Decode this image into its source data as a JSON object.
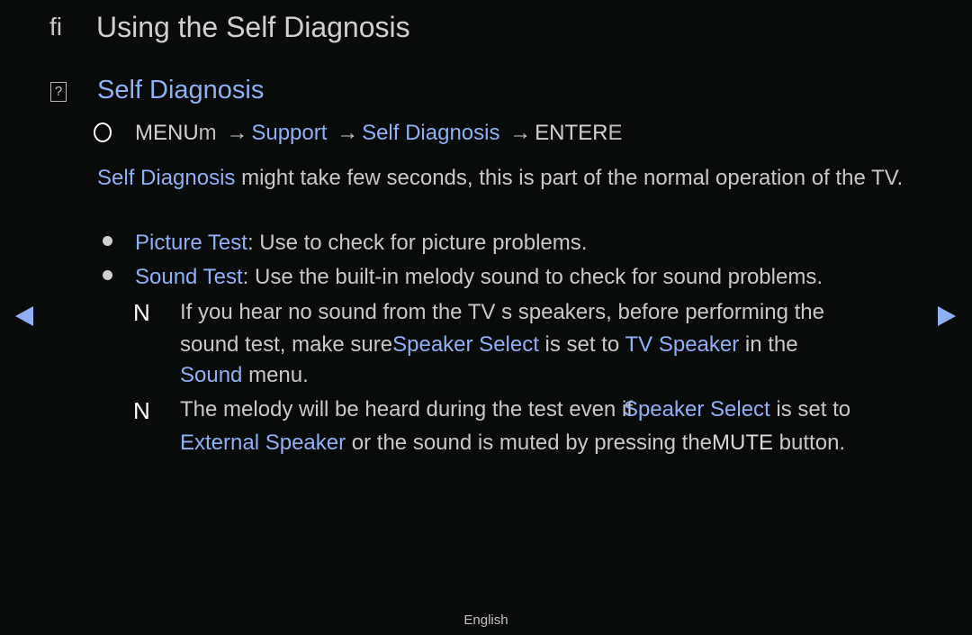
{
  "header": {
    "title_glyph": "ﬁ",
    "title": "Using the Self Diagnosis"
  },
  "section": {
    "glyph": "?",
    "title": "Self Diagnosis"
  },
  "menu_path": {
    "o_icon": "remote-button-icon",
    "menu": "MENU",
    "menu_suffix": "m",
    "arrow": "→",
    "support": "Support",
    "self_diagnosis": "Self Diagnosis",
    "enter": "ENTER",
    "enter_suffix": "E"
  },
  "intro": {
    "highlight": "Self Diagnosis",
    "text": " might take few seconds, this is part of the normal operation of the TV."
  },
  "bullets": [
    {
      "label": "Picture Test",
      "text": ": Use to check for picture problems."
    },
    {
      "label": "Sound Test",
      "text": ": Use the built-in melody sound to check for sound problems."
    }
  ],
  "notes": [
    {
      "glyph": "N",
      "line1": "If you hear no sound from the TV s speakers, before performing the",
      "line2_pre": "sound test, make sure",
      "line2_hl1": "Speaker Select",
      "line2_mid": " is set to ",
      "line2_hl2": "TV Speaker",
      "line2_post": " in the",
      "line3_hl": "Sound",
      "line3_post": " menu."
    },
    {
      "glyph": "N",
      "line1_pre": "The melody will be heard during the test even if",
      "line1_hl": "Speaker Select",
      "line1_post": " is set to",
      "line2_hl": "External Speaker",
      "line2_mid": " or the sound is muted by pressing the",
      "line2_bold": "MUTE",
      "line2_post": " button."
    }
  ],
  "navigation": {
    "prev_icon": "left-triangle-icon",
    "next_icon": "right-triangle-icon"
  },
  "footer": {
    "language": "English"
  },
  "colors": {
    "background": "#090b0b",
    "highlight": "#8fb0f5",
    "text": "#c8c8c8"
  }
}
